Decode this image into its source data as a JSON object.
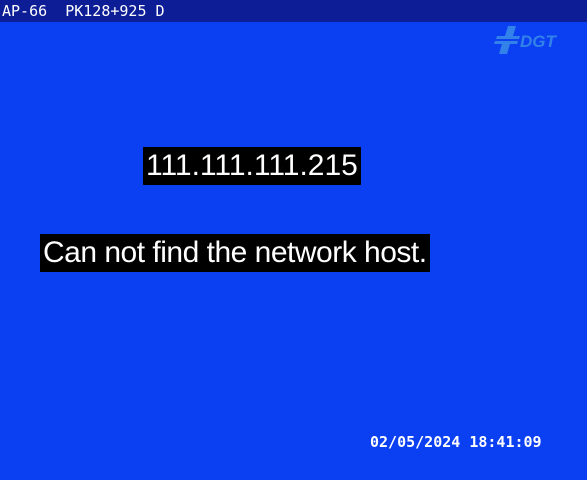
{
  "header": {
    "camera_label": "AP-66  PK128+925 D"
  },
  "logo": {
    "text": "DGT"
  },
  "overlay": {
    "ip_address": "111.111.111.215",
    "error_message": "Can not find the network host."
  },
  "timestamp": "02/05/2024 18:41:09",
  "colors": {
    "background": "#0b3ff2",
    "header_bar": "#0c1d96",
    "logo": "#3a8ee8"
  }
}
